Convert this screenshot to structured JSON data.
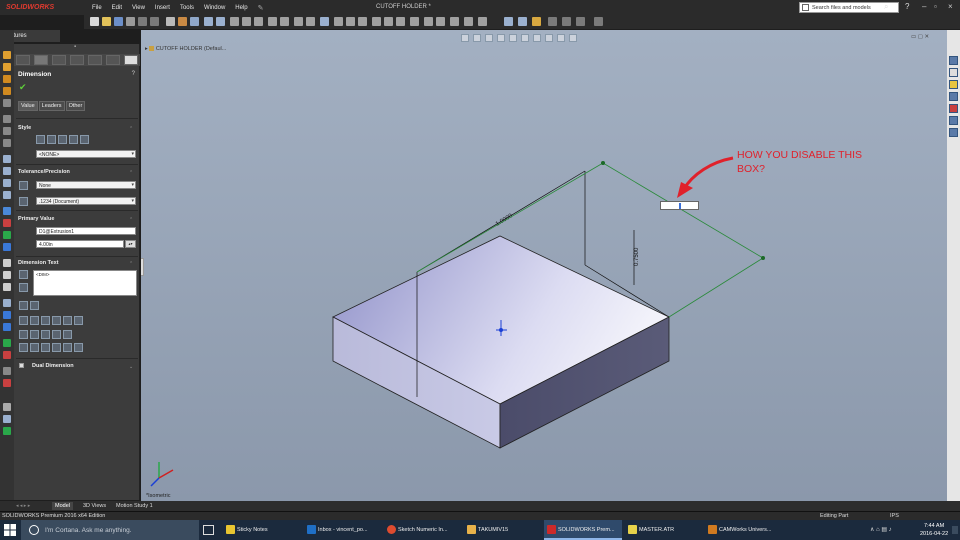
{
  "app": {
    "logo": "SOLIDWORKS",
    "document_title": "CUTOFF HOLDER *",
    "menus": [
      "File",
      "Edit",
      "View",
      "Insert",
      "Tools",
      "Window",
      "Help"
    ]
  },
  "search": {
    "placeholder": "Search files and models"
  },
  "feature_tab": {
    "label": "Features"
  },
  "property_manager": {
    "title": "Dimension",
    "tabs": [
      "Value",
      "Leaders",
      "Other"
    ],
    "style": {
      "header": "Style",
      "select": "<NONE>"
    },
    "tolerance": {
      "header": "Tolerance/Precision",
      "type": "None",
      "precision": ".1234 (Document)"
    },
    "primary_value": {
      "header": "Primary Value",
      "name": "D1@Extrusion1",
      "value": "4.00in"
    },
    "dimension_text": {
      "header": "Dimension Text",
      "content": "<DIM>"
    },
    "dual_dimension": {
      "label": "Dual Dimension"
    }
  },
  "graphics": {
    "tree_label": "CUTOFF HOLDER  (Defaul...",
    "view_label": "*Isometric",
    "dimension_labels": [
      "1.0000",
      "0.7500"
    ],
    "annotation": {
      "line1": "HOW YOU DISABLE THIS",
      "line2": "BOX?",
      "color": "#e0212b"
    }
  },
  "bottom_tabs": [
    "Model",
    "3D Views",
    "Motion Study 1"
  ],
  "status": {
    "product": "SOLIDWORKS Premium 2016 x64 Edition",
    "editing": "Editing Part",
    "units": "IPS"
  },
  "taskbar": {
    "cortana": "I'm Cortana. Ask me anything.",
    "apps": [
      {
        "label": "Sticky Notes",
        "color": "#e8c531"
      },
      {
        "label": "Inbox - vincent_po...",
        "color": "#1f6fc6"
      },
      {
        "label": "Sketch Numeric In...",
        "color": "#dd4b2f"
      },
      {
        "label": "TAKUMIV15",
        "color": "#e8b24a"
      },
      {
        "label": "SOLIDWORKS Prem...",
        "color": "#cc2a2a"
      },
      {
        "label": "MASTER.ATR",
        "color": "#e6d24a"
      },
      {
        "label": "CAMWorks Univers...",
        "color": "#d07a20"
      }
    ],
    "time": "7:44 AM",
    "date": "2016-04-22"
  }
}
